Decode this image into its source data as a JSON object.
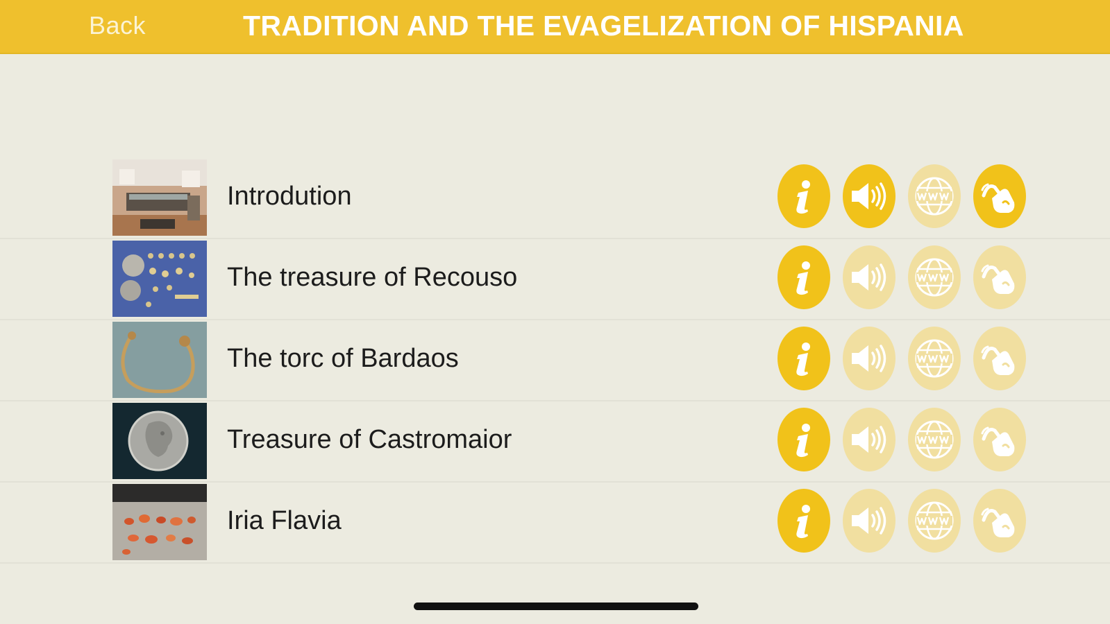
{
  "header": {
    "back_label": "Back",
    "title": "TRADITION AND THE EVAGELIZATION OF HISPANIA"
  },
  "colors": {
    "accent": "#efc02d",
    "button_active": "#f1c21a",
    "button_inactive": "#f1dfa0",
    "background": "#ecebe0"
  },
  "items": [
    {
      "label": "Introdution",
      "image": "museum-room-photo",
      "info": true,
      "audio": true,
      "web": false,
      "sign_language": true
    },
    {
      "label": "The treasure of Recouso",
      "image": "jewelry-treasure-photo",
      "info": true,
      "audio": false,
      "web": false,
      "sign_language": false
    },
    {
      "label": "The torc of Bardaos",
      "image": "gold-torc-photo",
      "info": true,
      "audio": false,
      "web": false,
      "sign_language": false
    },
    {
      "label": "Treasure of Castromaior",
      "image": "silver-coin-photo",
      "info": true,
      "audio": false,
      "web": false,
      "sign_language": false
    },
    {
      "label": "Iria Flavia",
      "image": "amber-beads-photo",
      "info": true,
      "audio": false,
      "web": false,
      "sign_language": false
    }
  ],
  "icons": {
    "info": "info-icon",
    "audio": "speaker-icon",
    "web": "www-globe-icon",
    "sign_language": "sign-language-icon"
  }
}
